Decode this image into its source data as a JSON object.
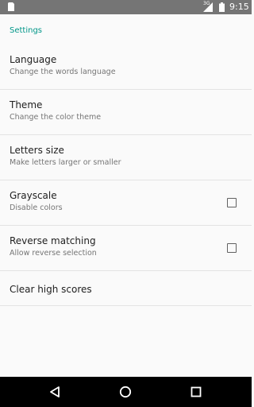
{
  "status_bar": {
    "network_type": "3G",
    "time": "9:15",
    "icons": [
      "sim-card-icon",
      "signal-icon",
      "battery-icon"
    ]
  },
  "settings": {
    "section_title": "Settings",
    "items": [
      {
        "title": "Language",
        "summary": "Change the words language"
      },
      {
        "title": "Theme",
        "summary": "Change the color theme"
      },
      {
        "title": "Letters size",
        "summary": "Make letters larger or smaller"
      },
      {
        "title": "Grayscale",
        "summary": "Disable colors",
        "checked": false
      },
      {
        "title": "Reverse matching",
        "summary": "Allow reverse selection",
        "checked": false
      },
      {
        "title": "Clear high scores"
      }
    ]
  },
  "nav_bar": {
    "buttons": [
      "back-icon",
      "home-icon",
      "recents-icon"
    ]
  },
  "colors": {
    "accent": "#009688",
    "status_bar": "#757575",
    "background": "#fafafa",
    "nav_bar": "#000000"
  }
}
